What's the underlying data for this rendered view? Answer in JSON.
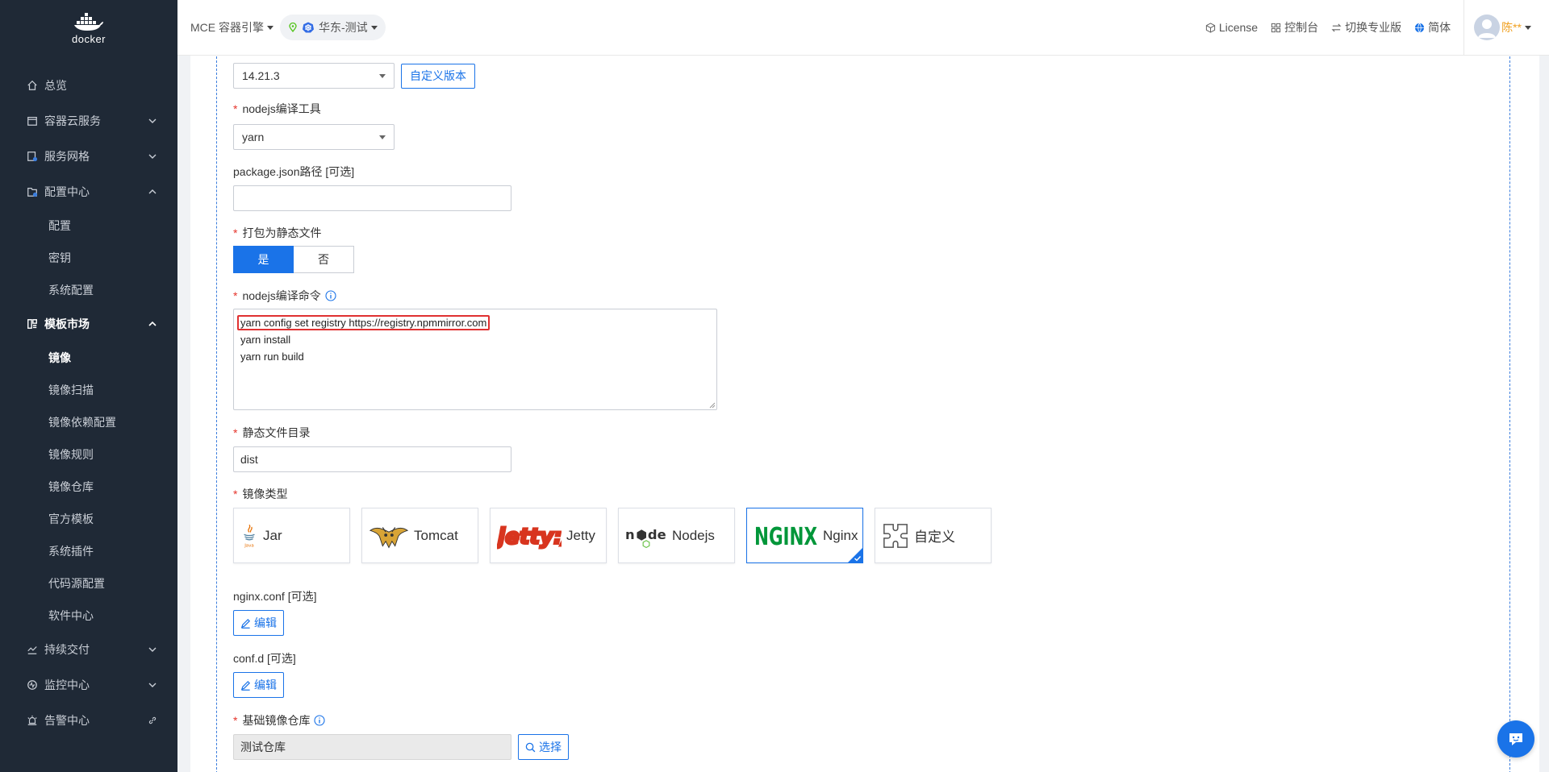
{
  "brand": {
    "logo_text": "docker"
  },
  "sidebar": {
    "items": [
      {
        "label": "总览",
        "icon": "home-icon"
      },
      {
        "label": "容器云服务",
        "icon": "box-icon"
      },
      {
        "label": "服务网格",
        "icon": "mesh-icon"
      },
      {
        "label": "配置中心",
        "icon": "config-icon"
      },
      {
        "label": "模板市场",
        "icon": "template-icon"
      },
      {
        "label": "持续交付",
        "icon": "delivery-icon"
      },
      {
        "label": "监控中心",
        "icon": "monitor-icon"
      },
      {
        "label": "告警中心",
        "icon": "alarm-icon"
      }
    ],
    "config_sub": [
      "配置",
      "密钥",
      "系统配置"
    ],
    "template_sub": [
      "镜像",
      "镜像扫描",
      "镜像依赖配置",
      "镜像规则",
      "镜像仓库",
      "官方模板",
      "系统插件",
      "代码源配置",
      "软件中心"
    ]
  },
  "header": {
    "product": "MCE 容器引擎",
    "region": "华东-测试",
    "links": [
      "License",
      "控制台",
      "切换专业版",
      "简体"
    ],
    "user": "陈**"
  },
  "form": {
    "node_version": {
      "value": "14.21.3",
      "custom_btn": "自定义版本"
    },
    "build_tool": {
      "label": "nodejs编译工具",
      "value": "yarn"
    },
    "package_json": {
      "label": "package.json路径 [可选]",
      "value": ""
    },
    "static_pack": {
      "label": "打包为静态文件",
      "yes": "是",
      "no": "否"
    },
    "build_cmd": {
      "label": "nodejs编译命令",
      "lines": [
        "yarn config set registry https://registry.npmmirror.com",
        "yarn install",
        "yarn run build"
      ]
    },
    "static_dir": {
      "label": "静态文件目录",
      "value": "dist"
    },
    "image_type": {
      "label": "镜像类型",
      "options": [
        "Jar",
        "Tomcat",
        "Jetty",
        "Nodejs",
        "Nginx",
        "自定义"
      ],
      "selected": "Nginx"
    },
    "nginx_conf": {
      "label": "nginx.conf [可选]",
      "btn": "编辑"
    },
    "confd": {
      "label": "conf.d [可选]",
      "btn": "编辑"
    },
    "base_repo": {
      "label": "基础镜像仓库",
      "value": "测试仓库",
      "btn": "选择"
    }
  },
  "colors": {
    "primary": "#1a73e8",
    "sidebar_bg": "#1f2936",
    "required": "#e5342b",
    "highlight": "#e03131"
  }
}
